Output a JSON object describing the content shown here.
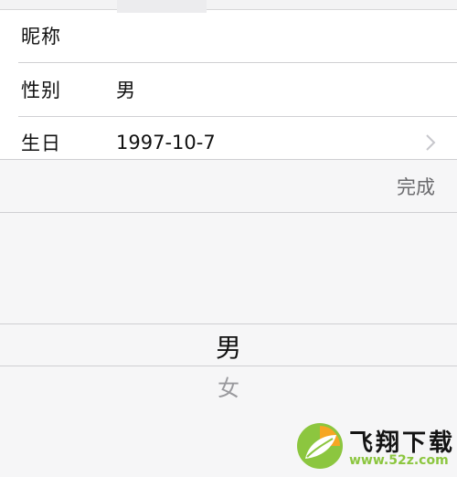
{
  "form": {
    "nickname": {
      "label": "昵称",
      "value": ""
    },
    "gender": {
      "label": "性别",
      "value": "男"
    },
    "birthday": {
      "label": "生日",
      "value": "1997-10-7"
    }
  },
  "toolbar": {
    "done_label": "完成"
  },
  "picker": {
    "options": [
      "男",
      "女"
    ],
    "selected": "男"
  },
  "watermark": {
    "title": "飞翔下载",
    "url": "www.52z.com"
  },
  "icons": {
    "chevron": "chevron-right-icon",
    "watermark_logo": "leaf-logo-icon"
  },
  "colors": {
    "watermark_green": "#8cc63f",
    "watermark_orange": "#f6a623"
  }
}
